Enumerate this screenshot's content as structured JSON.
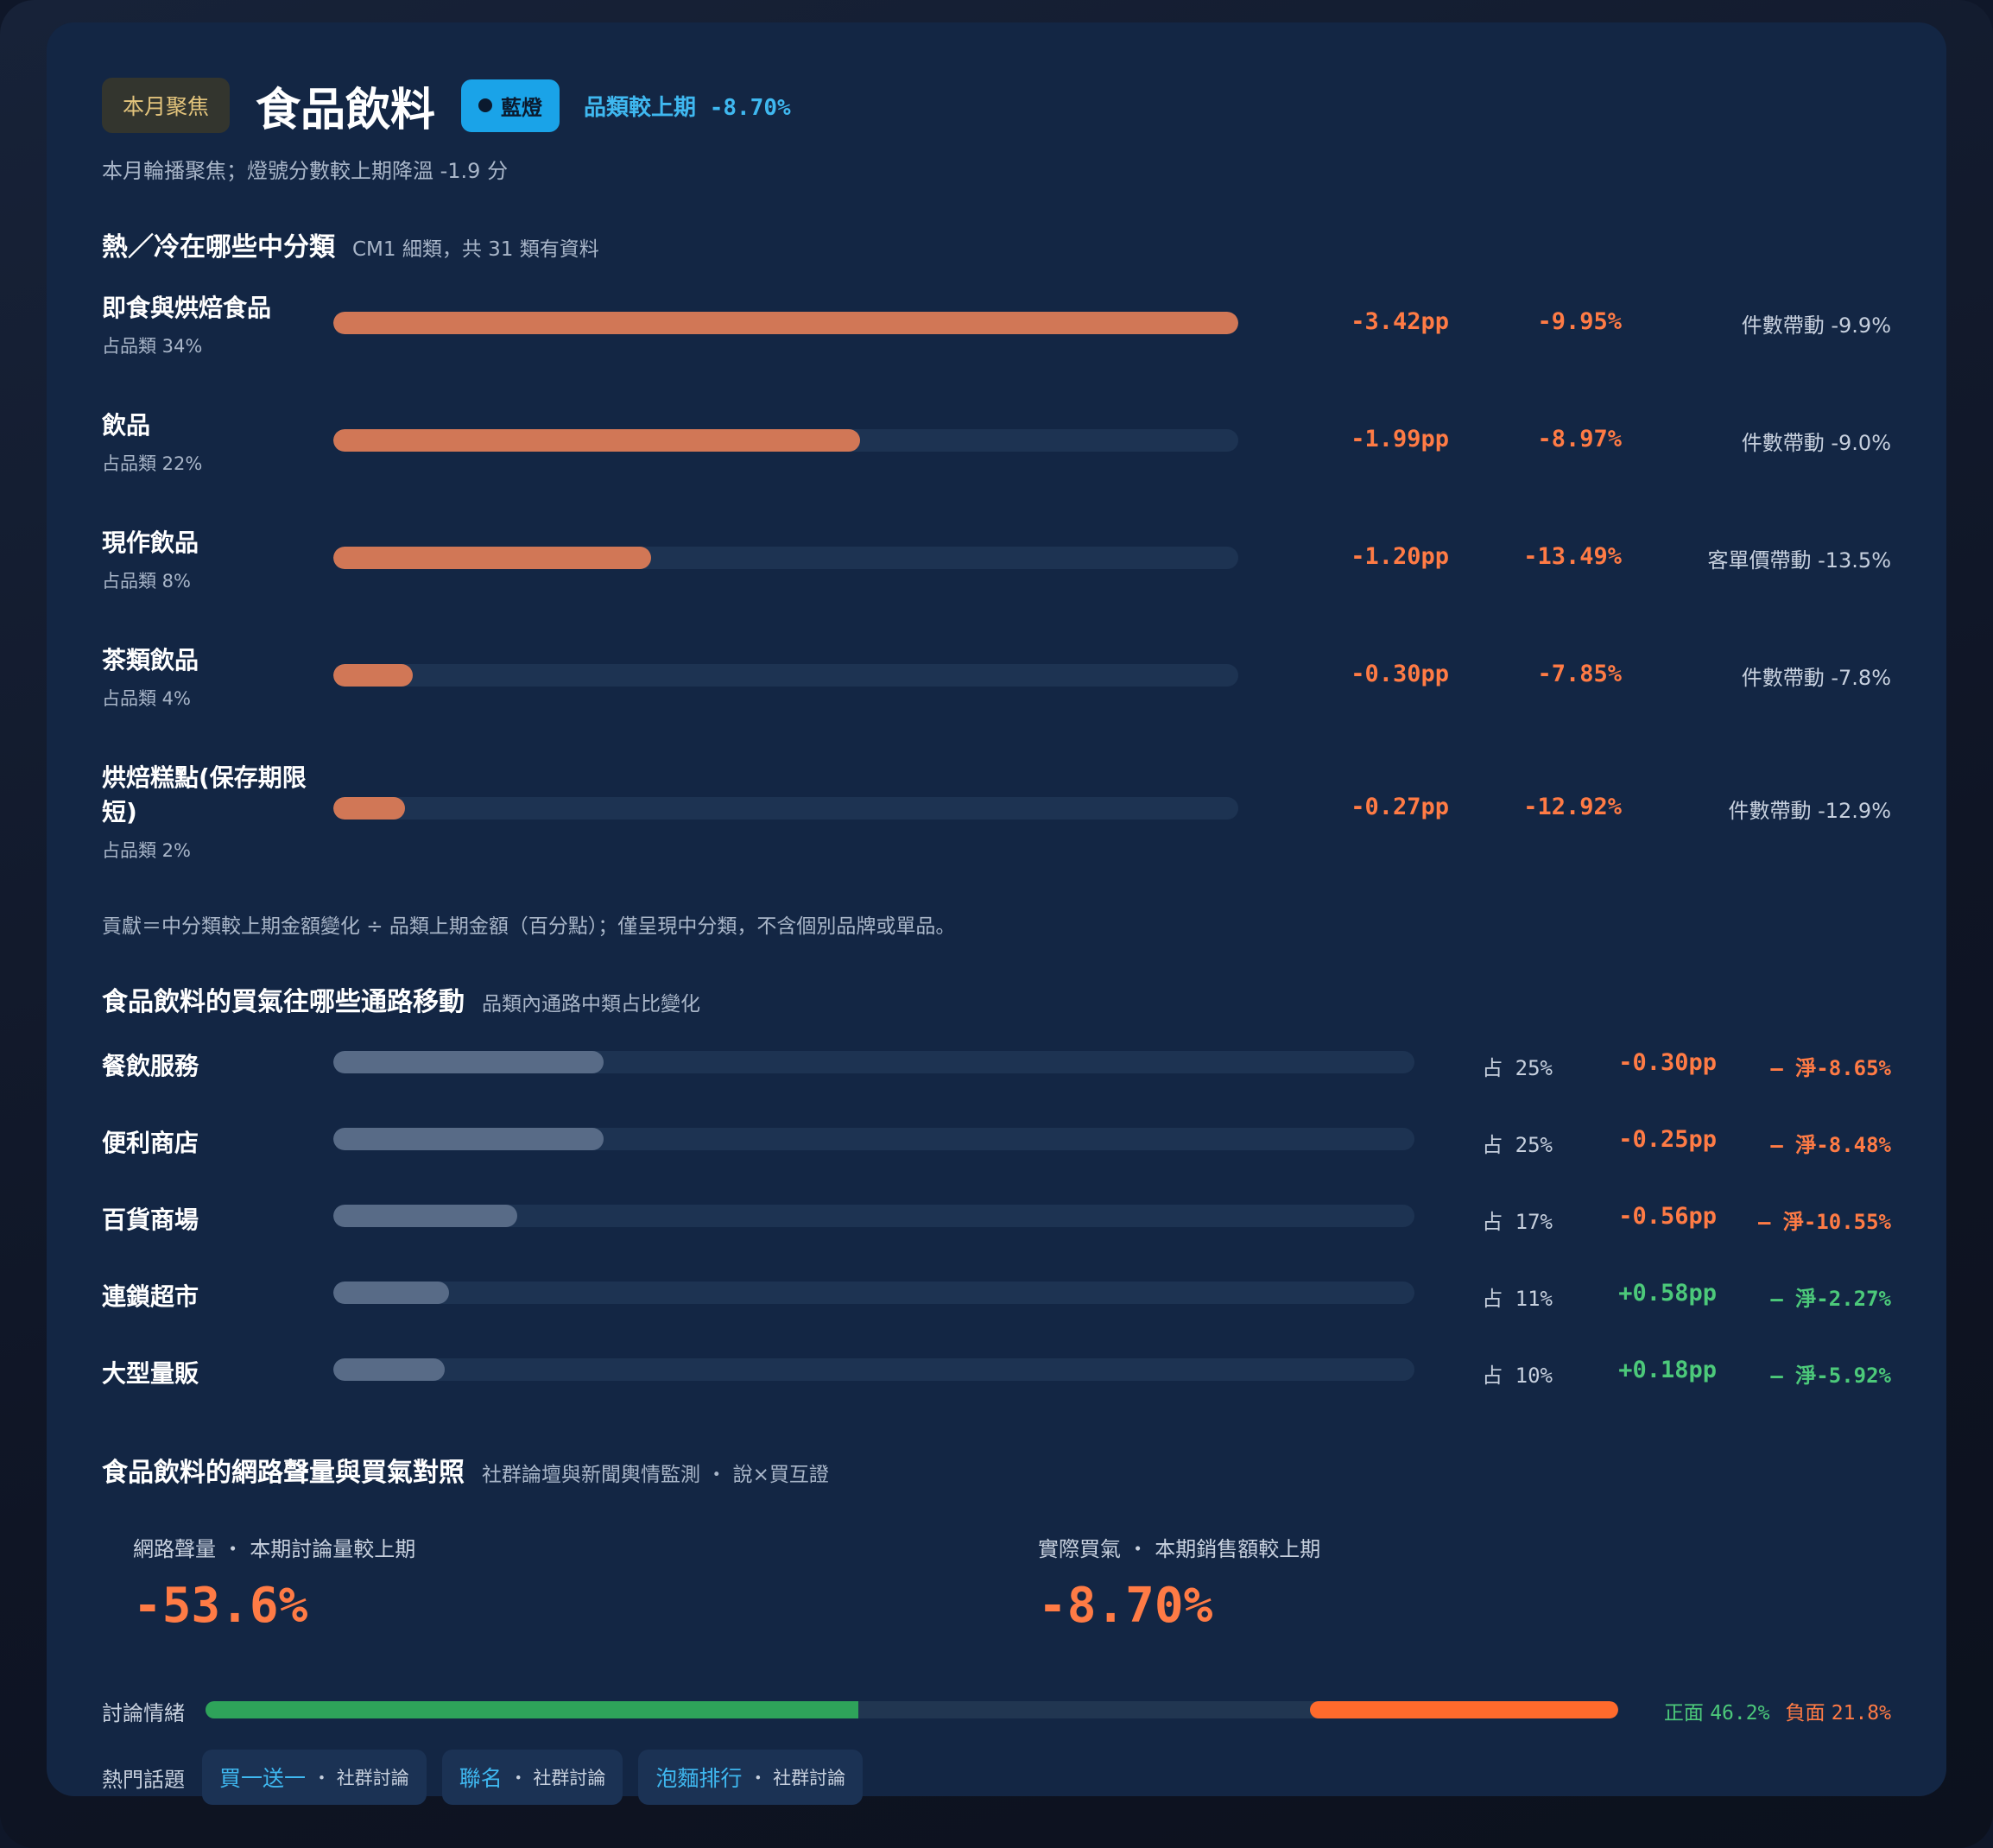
{
  "header": {
    "focus_badge": "本月聚焦",
    "category": "食品飲料",
    "light_label": "藍燈",
    "delta_label": "品類較上期",
    "delta_value": "-8.70%",
    "subtitle": "本月輪播聚焦；燈號分數較上期降溫 -1.9 分"
  },
  "subcategories": {
    "title": "熱／冷在哪些中分類",
    "subtitle": "CM1 細類，共 31 類有資料",
    "share_prefix": "占品類",
    "rows": [
      {
        "name": "即食與烘焙食品",
        "share": "34%",
        "bar_fraction": 1.0,
        "contribution": "-3.42pp",
        "change": "-9.95%",
        "driver": "件數帶動 -9.9%"
      },
      {
        "name": "飲品",
        "share": "22%",
        "bar_fraction": 0.582,
        "contribution": "-1.99pp",
        "change": "-8.97%",
        "driver": "件數帶動 -9.0%"
      },
      {
        "name": "現作飲品",
        "share": "8%",
        "bar_fraction": 0.351,
        "contribution": "-1.20pp",
        "change": "-13.49%",
        "driver": "客單價帶動 -13.5%"
      },
      {
        "name": "茶類飲品",
        "share": "4%",
        "bar_fraction": 0.088,
        "contribution": "-0.30pp",
        "change": "-7.85%",
        "driver": "件數帶動 -7.8%"
      },
      {
        "name": "烘焙糕點(保存期限短)",
        "share": "2%",
        "bar_fraction": 0.079,
        "contribution": "-0.27pp",
        "change": "-12.92%",
        "driver": "件數帶動 -12.9%"
      }
    ],
    "footnote": "貢獻＝中分類較上期金額變化 ÷ 品類上期金額（百分點）；僅呈現中分類，不含個別品牌或單品。"
  },
  "channels": {
    "title": "食品飲料的買氣往哪些通路移動",
    "subtitle": "品類內通路中類占比變化",
    "share_prefix": "占",
    "rows": [
      {
        "name": "餐飲服務",
        "share": "25%",
        "bar_fraction": 0.25,
        "pp": "-0.30pp",
        "pp_dir": "neg",
        "net": "— 淨-8.65%",
        "net_dir": "neg"
      },
      {
        "name": "便利商店",
        "share": "25%",
        "bar_fraction": 0.25,
        "pp": "-0.25pp",
        "pp_dir": "neg",
        "net": "— 淨-8.48%",
        "net_dir": "neg"
      },
      {
        "name": "百貨商場",
        "share": "17%",
        "bar_fraction": 0.17,
        "pp": "-0.56pp",
        "pp_dir": "neg",
        "net": "— 淨-10.55%",
        "net_dir": "neg"
      },
      {
        "name": "連鎖超市",
        "share": "11%",
        "bar_fraction": 0.107,
        "pp": "+0.58pp",
        "pp_dir": "pos",
        "net": "— 淨-2.27%",
        "net_dir": "pos"
      },
      {
        "name": "大型量販",
        "share": "10%",
        "bar_fraction": 0.103,
        "pp": "+0.18pp",
        "pp_dir": "pos",
        "net": "— 淨-5.92%",
        "net_dir": "pos"
      }
    ]
  },
  "buzz": {
    "title": "食品飲料的網路聲量與買氣對照",
    "subtitle": "社群論壇與新聞輿情監測 ・ 說×買互證",
    "volume_label": "網路聲量 ・ 本期討論量較上期",
    "volume_value": "-53.6%",
    "sales_label": "實際買氣 ・ 本期銷售額較上期",
    "sales_value": "-8.70%",
    "sentiment_label": "討論情緒",
    "positive_label": "正面",
    "positive_value": "46.2%",
    "positive_fraction": 0.462,
    "negative_label": "負面",
    "negative_value": "21.8%",
    "negative_fraction": 0.218,
    "topics_label": "熱門話題",
    "topics": [
      {
        "keyword": "買一送一",
        "source": "・ 社群討論"
      },
      {
        "keyword": "聯名",
        "source": "・ 社群討論"
      },
      {
        "keyword": "泡麵排行",
        "source": "・ 社群討論"
      }
    ]
  }
}
